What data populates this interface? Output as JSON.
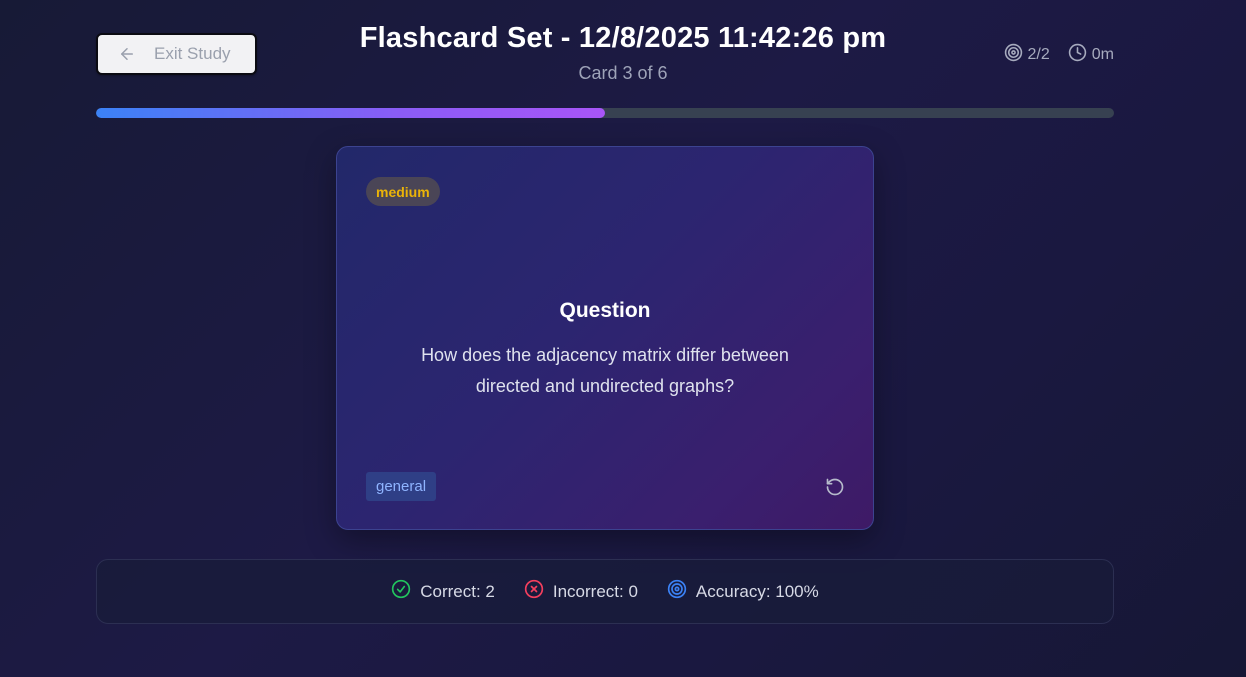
{
  "header": {
    "exit_label": "Exit Study",
    "title": "Flashcard Set - 12/8/2025 11:42:26 pm",
    "subtitle": "Card 3 of 6",
    "stats": {
      "score": "2/2",
      "time": "0m"
    }
  },
  "progress": {
    "fraction": 0.5
  },
  "card": {
    "difficulty": "medium",
    "heading": "Question",
    "text": "How does the adjacency matrix differ between directed and undirected graphs?",
    "tag": "general"
  },
  "summary": {
    "correct": "Correct: 2",
    "incorrect": "Incorrect: 0",
    "accuracy": "Accuracy: 100%"
  },
  "icons": {
    "exit": "arrow-left-icon",
    "score": "target-icon",
    "time": "clock-icon",
    "flip": "rotate-ccw-icon",
    "correct": "check-circle-icon",
    "incorrect": "x-circle-icon",
    "accuracy": "target-icon"
  },
  "colors": {
    "progress_start": "#3b82f6",
    "progress_end": "#a855f7",
    "difficulty_medium": "#eab308",
    "tag_text": "#8fb4ff",
    "correct": "#22c55e",
    "incorrect": "#f43f5e",
    "accuracy": "#3b82f6"
  }
}
